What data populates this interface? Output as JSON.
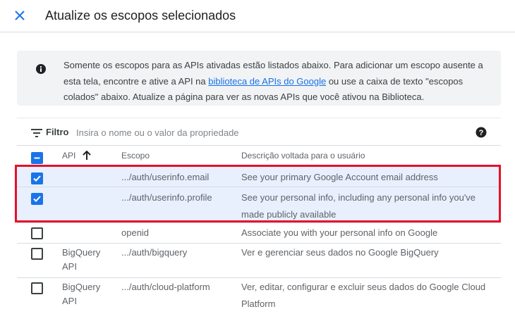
{
  "header": {
    "title": "Atualize os escopos selecionados",
    "close_icon": "close-icon"
  },
  "info": {
    "icon": "info-icon",
    "text_before": "Somente os escopos para as APIs ativadas estão listados abaixo. Para adicionar um escopo ausente a esta tela, encontre e ative a API na ",
    "link_text": "biblioteca de APIs do Google",
    "text_after": " ou use a caixa de texto \"escopos colados\" abaixo. Atualize a página para ver as novas APIs que você ativou na Biblioteca."
  },
  "filter": {
    "label": "Filtro",
    "placeholder": "Insira o nome ou o valor da propriedade",
    "icon": "filter-icon",
    "help_icon": "help-icon"
  },
  "table": {
    "headers": {
      "api": "API",
      "scope": "Escopo",
      "description": "Descrição voltada para o usuário"
    },
    "sort_icon": "arrow-up-icon",
    "header_checkbox": "indeterminate",
    "rows": [
      {
        "checked": true,
        "api": "",
        "scope": ".../auth/userinfo.email",
        "description": "See your primary Google Account email address"
      },
      {
        "checked": true,
        "api": "",
        "scope": ".../auth/userinfo.profile",
        "description": "See your personal info, including any personal info you've made publicly available"
      },
      {
        "checked": false,
        "api": "",
        "scope": "openid",
        "description": "Associate you with your personal info on Google"
      },
      {
        "checked": false,
        "api": "BigQuery API",
        "scope": ".../auth/bigquery",
        "description": "Ver e gerenciar seus dados no Google BigQuery"
      },
      {
        "checked": false,
        "api": "BigQuery API",
        "scope": ".../auth/cloud-platform",
        "description": "Ver, editar, configurar e excluir seus dados do Google Cloud Platform"
      }
    ]
  },
  "colors": {
    "accent": "#1a73e8",
    "selected_row": "#e8f0fe",
    "highlight_border": "#e8102a"
  }
}
